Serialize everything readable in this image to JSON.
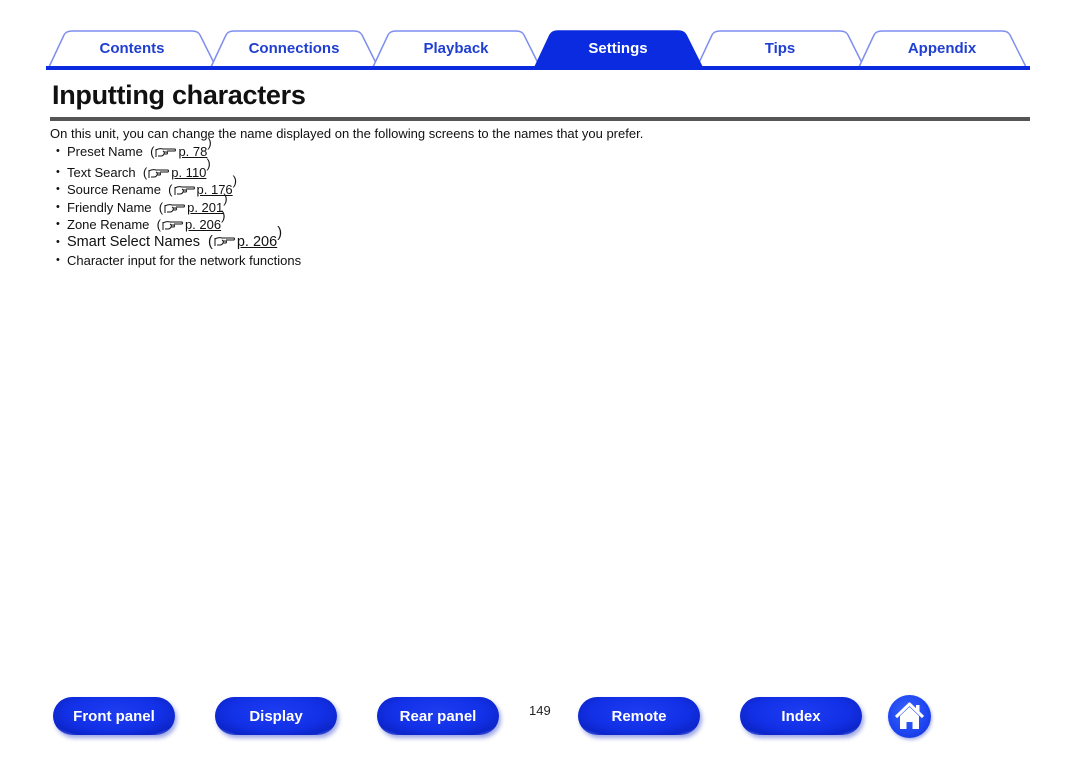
{
  "tabs": [
    {
      "label": "Contents",
      "active": false
    },
    {
      "label": "Connections",
      "active": false
    },
    {
      "label": "Playback",
      "active": false
    },
    {
      "label": "Settings",
      "active": true
    },
    {
      "label": "Tips",
      "active": false
    },
    {
      "label": "Appendix",
      "active": false
    }
  ],
  "colors": {
    "accent": "#0a2be0",
    "tab_text": "#1f3fd1",
    "tab_border": "#7f8ff0"
  },
  "page": {
    "title": "Inputting characters",
    "intro": "On this unit, you can change the name displayed on the following screens to the names that you prefer.",
    "items": [
      {
        "label": "Preset Name",
        "ref": "p. 78",
        "icon": "pointing-hand-icon"
      },
      {
        "label": "Text Search",
        "ref": "p. 110",
        "icon": "pointing-hand-icon"
      },
      {
        "label": "Source Rename",
        "ref": "p. 176",
        "icon": "pointing-hand-icon"
      },
      {
        "label": "Friendly Name",
        "ref": "p. 201",
        "icon": "pointing-hand-icon"
      },
      {
        "label": "Zone Rename",
        "ref": "p. 206",
        "icon": "pointing-hand-icon"
      },
      {
        "label": "Smart Select Names",
        "ref": "p. 206",
        "icon": "pointing-hand-icon"
      },
      {
        "label": "Character input for the network functions"
      }
    ]
  },
  "footer": {
    "buttons": [
      "Front panel",
      "Display",
      "Rear panel",
      "Remote",
      "Index"
    ],
    "page_number": "149",
    "home_icon": "home-icon"
  }
}
